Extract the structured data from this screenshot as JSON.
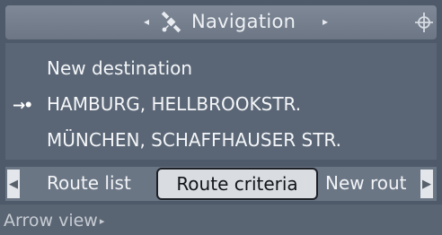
{
  "header": {
    "title": "Navigation",
    "prev_arrow": "◂",
    "next_arrow": "▸",
    "nav_icon": "satellite-navigation-icon",
    "corner_icon": "controller-icon"
  },
  "destinations": [
    {
      "label": "New destination",
      "active": false
    },
    {
      "label": "HAMBURG, HELLBROOKSTR.",
      "active": true,
      "icon": "→•"
    },
    {
      "label": "MÜNCHEN, SCHAFFHAUSER STR.",
      "active": false
    }
  ],
  "tabs": {
    "left_scroll": "◀",
    "right_scroll": "▶",
    "items": [
      {
        "label": "Route list",
        "selected": false
      },
      {
        "label": "Route criteria",
        "selected": true
      },
      {
        "label": "New rout",
        "selected": false
      }
    ]
  },
  "footer": {
    "label": "Arrow view",
    "chevron": "▸"
  },
  "colors": {
    "background": "#4e5a69",
    "panel": "#5a6676",
    "selected_tab_bg": "#d9dde2",
    "text": "#f4f6f8"
  }
}
